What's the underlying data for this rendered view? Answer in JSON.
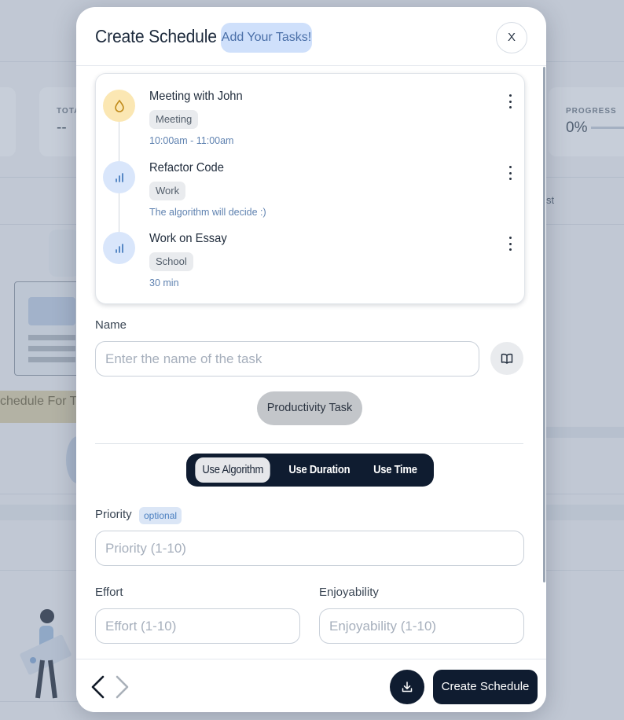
{
  "background": {
    "stat_total_label": "TOTA",
    "stat_total_value": "--",
    "stat_progress_label": "PROGRESS",
    "stat_progress_value": "0%",
    "side_text": "st",
    "banner_text": "chedule For T"
  },
  "modal": {
    "title": "Create Schedule",
    "badge": "Add Your Tasks!",
    "close_label": "X"
  },
  "tasks": [
    {
      "name": "Meeting with John",
      "tag": "Meeting",
      "detail": "10:00am - 11:00am",
      "icon": "drop-icon",
      "color": "#fbe7b3"
    },
    {
      "name": "Refactor Code",
      "tag": "Work",
      "detail": "The algorithm will decide :)",
      "icon": "bar-chart-icon",
      "color": "#d9e6fb"
    },
    {
      "name": "Work on Essay",
      "tag": "School",
      "detail": "30 min",
      "icon": "bar-chart-icon",
      "color": "#d9e6fb"
    }
  ],
  "form": {
    "name_label": "Name",
    "name_placeholder": "Enter the name of the task",
    "name_value": "",
    "task_type_button": "Productivity Task",
    "modes": [
      "Use Algorithm",
      "Use Duration",
      "Use Time"
    ],
    "active_mode": "Use Algorithm",
    "priority_label": "Priority",
    "priority_badge": "optional",
    "priority_placeholder": "Priority (1-10)",
    "effort_label": "Effort",
    "effort_placeholder": "Effort (1-10)",
    "enjoyability_label": "Enjoyability",
    "enjoyability_placeholder": "Enjoyability (1-10)"
  },
  "footer": {
    "create_label": "Create Schedule"
  },
  "colors": {
    "primary_dark": "#0f1c30",
    "accent_blue": "#cfe0fb",
    "meeting_yellow": "#fbe7b3"
  }
}
